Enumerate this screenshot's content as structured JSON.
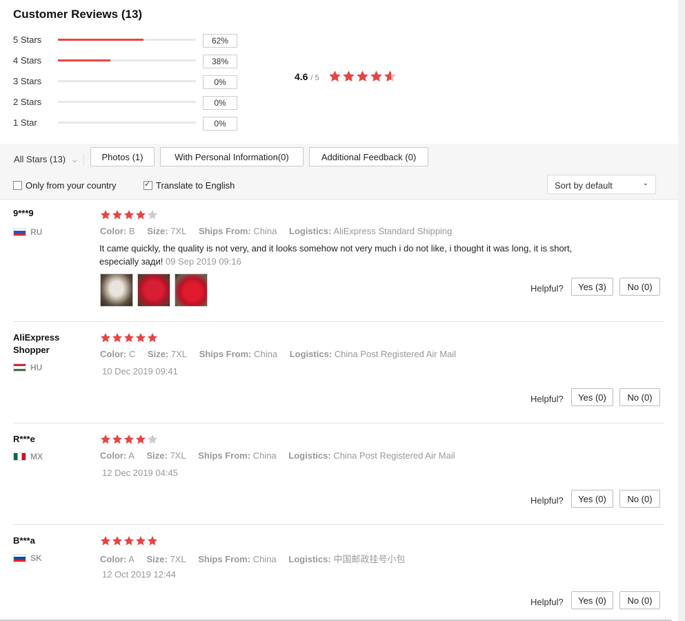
{
  "header": {
    "title": "Customer Reviews (13)"
  },
  "summary": {
    "rows": [
      {
        "label": "5 Stars",
        "pct": "62%",
        "fill": 0.62
      },
      {
        "label": "4 Stars",
        "pct": "38%",
        "fill": 0.38
      },
      {
        "label": "3 Stars",
        "pct": "0%",
        "fill": 0
      },
      {
        "label": "2 Stars",
        "pct": "0%",
        "fill": 0
      },
      {
        "label": "1 Star",
        "pct": "0%",
        "fill": 0
      }
    ],
    "average": "4.6",
    "out_of": "/ 5",
    "average_value": 4.6
  },
  "filters": {
    "all_stars": "All Stars (13)",
    "photos": "Photos (1)",
    "personal": "With Personal Information(0)",
    "additional": "Additional Feedback (0)",
    "only_country": "Only from your country",
    "only_country_checked": false,
    "translate": "Translate to English",
    "translate_checked": true,
    "sort": "Sort by default"
  },
  "labels": {
    "color": "Color:",
    "size": "Size:",
    "ships_from": "Ships From:",
    "logistics": "Logistics:",
    "helpful": "Helpful?"
  },
  "reviews": [
    {
      "name": "9***9",
      "country": "RU",
      "stars": 4,
      "color": "B",
      "size": "7XL",
      "ships_from": "China",
      "logistics": "AliExpress Standard Shipping",
      "text": "It came quickly, the quality is not very, and it looks somehow not very much i do not like, i thought it was long, it is short, especially зади!",
      "date": "09 Sep 2019 09:16",
      "yes": "Yes (3)",
      "no": "No (0)"
    },
    {
      "name": "AliExpress Shopper",
      "country": "HU",
      "stars": 5,
      "color": "C",
      "size": "7XL",
      "ships_from": "China",
      "logistics": "China Post Registered Air Mail",
      "date": "10 Dec 2019 09:41",
      "yes": "Yes (0)",
      "no": "No (0)"
    },
    {
      "name": "R***e",
      "country": "MX",
      "stars": 4,
      "color": "A",
      "size": "7XL",
      "ships_from": "China",
      "logistics": "China Post Registered Air Mail",
      "date": "12 Dec 2019 04:45",
      "yes": "Yes (0)",
      "no": "No (0)"
    },
    {
      "name": "B***a",
      "country": "SK",
      "stars": 5,
      "color": "A",
      "size": "7XL",
      "ships_from": "China",
      "logistics": "中国邮政挂号小包",
      "date": "12 Oct 2019 12:44",
      "yes": "Yes (0)",
      "no": "No (0)"
    }
  ],
  "colors": {
    "star": "#e64545",
    "star_empty": "#cccccc"
  }
}
